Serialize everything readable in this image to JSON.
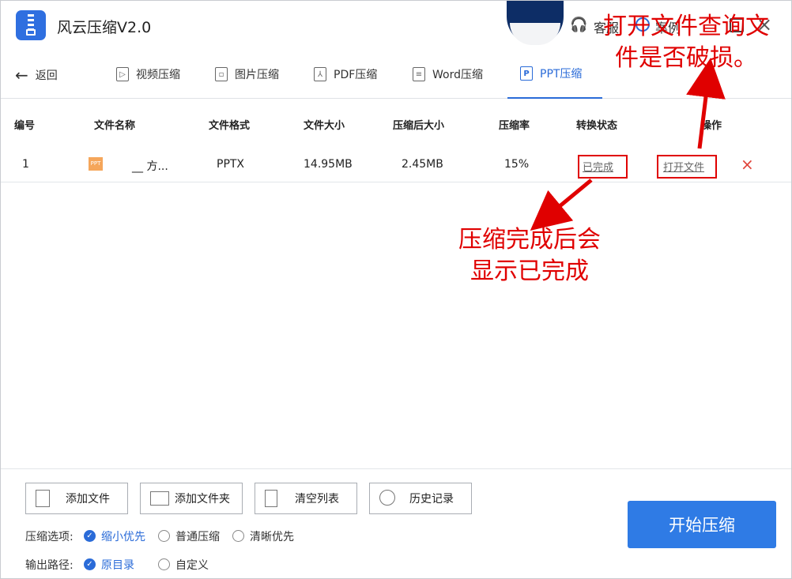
{
  "app": {
    "title": "风云压缩V2.0",
    "service": "客服",
    "case": "案例",
    "close": "×"
  },
  "nav": {
    "back": "返回",
    "tabs": [
      {
        "label": "视频压缩",
        "icon": "▷"
      },
      {
        "label": "图片压缩",
        "icon": "▫"
      },
      {
        "label": "PDF压缩",
        "icon": "⅄"
      },
      {
        "label": "Word压缩",
        "icon": "≡"
      },
      {
        "label": "PPT压缩",
        "icon": "P"
      }
    ]
  },
  "table": {
    "headers": [
      "编号",
      "文件名称",
      "文件格式",
      "文件大小",
      "压缩后大小",
      "压缩率",
      "转换状态",
      "操作"
    ],
    "rows": [
      {
        "index": "1",
        "icon_text": "PPT",
        "name": "__ 方...",
        "format": "PPTX",
        "size": "14.95MB",
        "compressed": "2.45MB",
        "ratio": "15%",
        "status": "已完成",
        "action": "打开文件",
        "delete": "×"
      }
    ]
  },
  "buttons": {
    "add_file": "添加文件",
    "add_folder": "添加文件夹",
    "clear_list": "清空列表",
    "history": "历史记录",
    "start": "开始压缩"
  },
  "options": {
    "compress_label": "压缩选项:",
    "compress": [
      "缩小优先",
      "普通压缩",
      "清晰优先"
    ],
    "output_label": "输出路径:",
    "output": [
      "原目录",
      "自定义"
    ]
  },
  "annotations": {
    "open_file": [
      "打开文件查询文",
      "件是否破损。"
    ],
    "completed": [
      "压缩完成后会",
      "显示已完成"
    ]
  },
  "colors": {
    "accent": "#2a6bd8",
    "annotation": "#e00000",
    "delete": "#e0443a"
  }
}
